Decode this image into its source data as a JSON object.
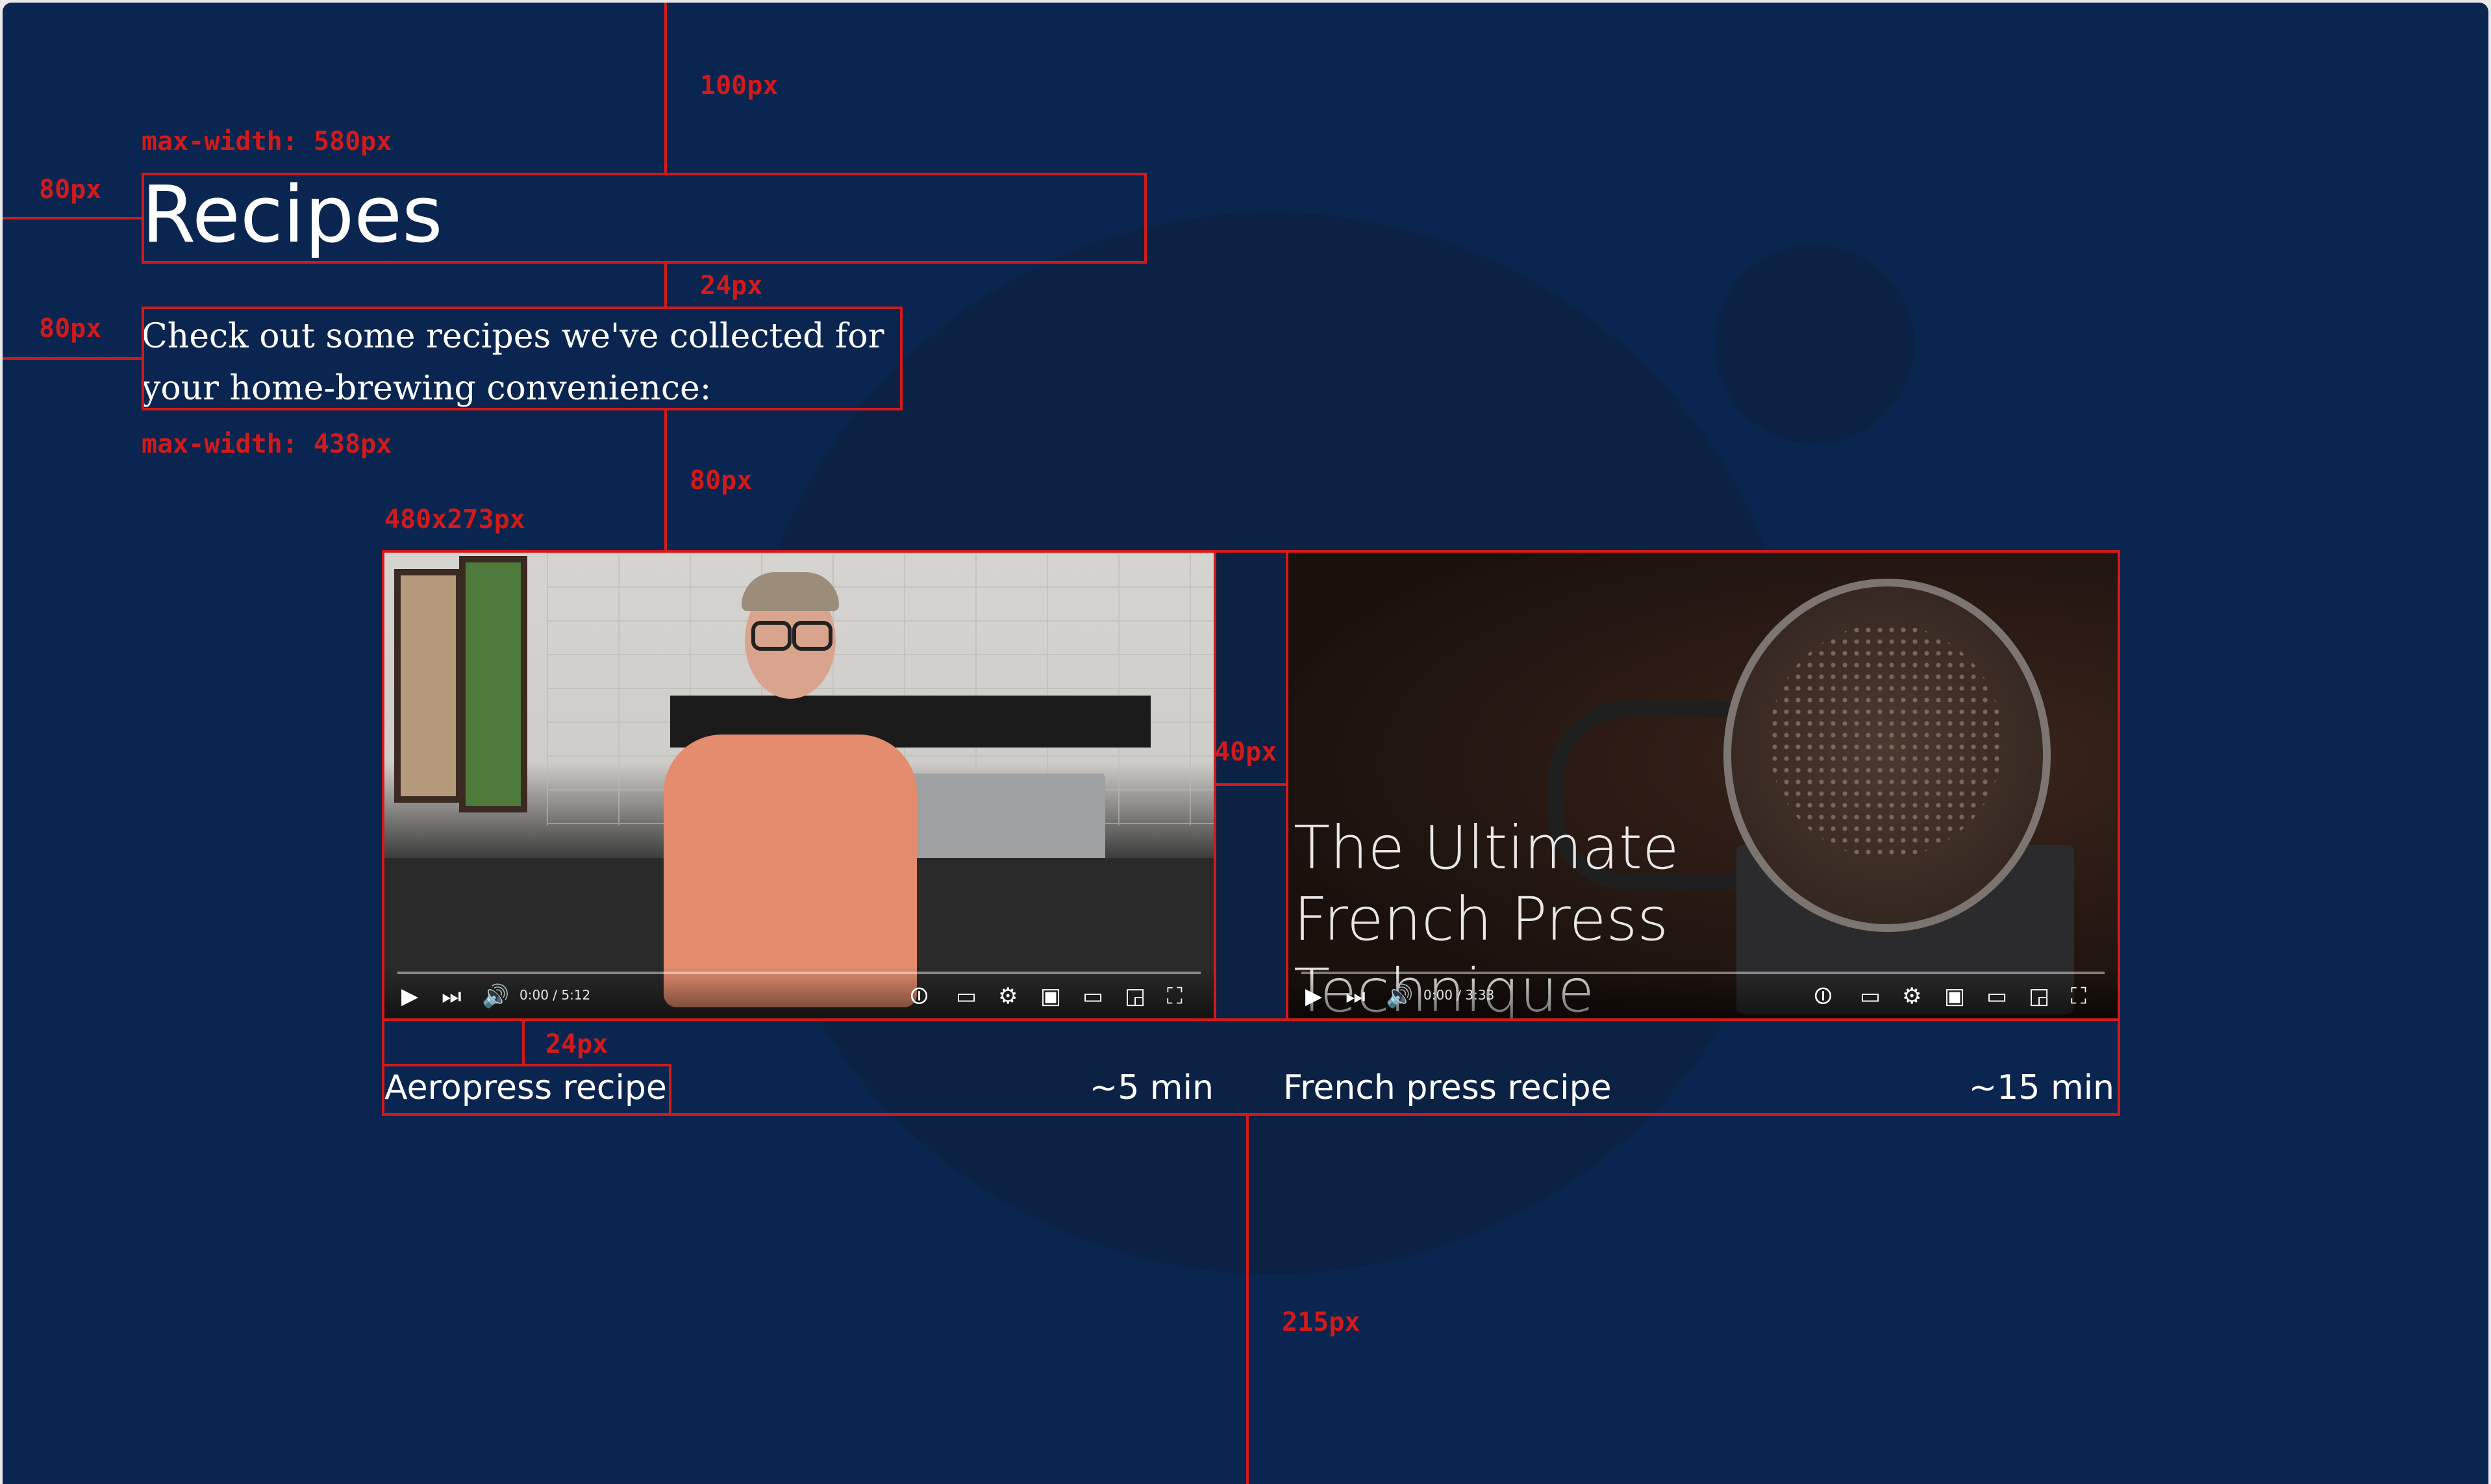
{
  "page": {
    "title": "Recipes",
    "description": "Check out some recipes we've collected for your home-brewing convenience:"
  },
  "annotations": {
    "top_spacing": "100px",
    "title_max_width": "max-width: 580px",
    "title_left_margin": "80px",
    "title_gap": "24px",
    "desc_left_margin": "80px",
    "desc_max_width": "max-width: 438px",
    "desc_gap": "80px",
    "video_size": "480x273px",
    "video_gap": "40px",
    "caption_gap": "24px",
    "bottom_spacing": "215px"
  },
  "videos": [
    {
      "caption": "Aeropress recipe",
      "duration": "~5 min",
      "player_time": "0:00 / 5:12"
    },
    {
      "caption": "French press recipe",
      "duration": "~15 min",
      "player_time": "0:00 / 3:33",
      "overlay_text": "The Ultimate French Press Technique"
    }
  ],
  "player_icons": [
    "play-icon",
    "next-icon",
    "volume-icon",
    "autoplay-toggle-icon",
    "subtitles-icon",
    "settings-icon",
    "miniplayer-icon",
    "theater-icon",
    "cast-icon",
    "fullscreen-icon"
  ],
  "colors": {
    "background": "#0a2550",
    "circle": "#0b2245",
    "guide": "#d21a1a",
    "text": "#ffffff"
  }
}
